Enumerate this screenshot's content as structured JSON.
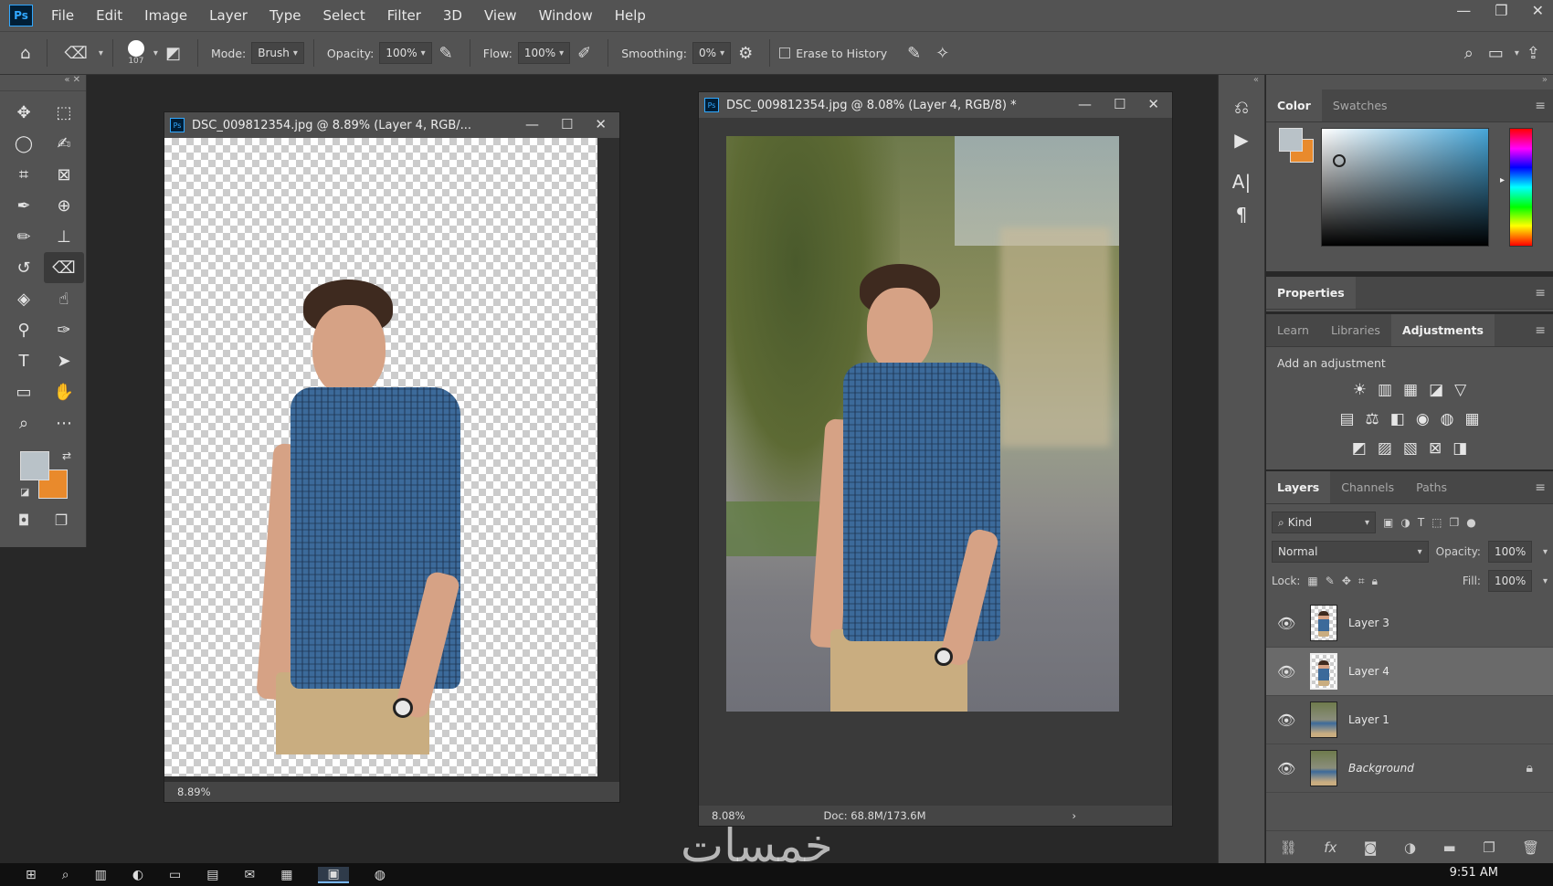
{
  "app": {
    "logo": "Ps",
    "menu": [
      "File",
      "Edit",
      "Image",
      "Layer",
      "Type",
      "Select",
      "Filter",
      "3D",
      "View",
      "Window",
      "Help"
    ],
    "window_controls": [
      "—",
      "❐",
      "✕"
    ]
  },
  "options_bar": {
    "brush_size": "107",
    "mode_label": "Mode:",
    "mode_value": "Brush",
    "opacity_label": "Opacity:",
    "opacity_value": "100%",
    "flow_label": "Flow:",
    "flow_value": "100%",
    "smoothing_label": "Smoothing:",
    "smoothing_value": "0%",
    "erase_to_history_label": "Erase to History"
  },
  "toolbar": {
    "foreground_color": "#b9c2c8",
    "background_color": "#e98a2c"
  },
  "documents": [
    {
      "title": "DSC_009812354.jpg @ 8.89% (Layer 4, RGB/...",
      "zoom": "8.89%"
    },
    {
      "title": "DSC_009812354.jpg @ 8.08% (Layer 4, RGB/8) *",
      "zoom": "8.08%",
      "doc_info": "Doc: 68.8M/173.6M"
    }
  ],
  "color_panel": {
    "tabs": [
      "Color",
      "Swatches"
    ],
    "active_tab": "Color"
  },
  "properties_panel": {
    "title": "Properties"
  },
  "adjustments_panel": {
    "tabs": [
      "Learn",
      "Libraries",
      "Adjustments"
    ],
    "active_tab": "Adjustments",
    "add_label": "Add an adjustment"
  },
  "layers_panel": {
    "tabs": [
      "Layers",
      "Channels",
      "Paths"
    ],
    "active_tab": "Layers",
    "filter_label": "Kind",
    "blend_mode": "Normal",
    "opacity_label": "Opacity:",
    "opacity_value": "100%",
    "lock_label": "Lock:",
    "fill_label": "Fill:",
    "fill_value": "100%",
    "layers": [
      {
        "name": "Layer 3",
        "selected": false,
        "thumb": "check"
      },
      {
        "name": "Layer 4",
        "selected": true,
        "thumb": "check"
      },
      {
        "name": "Layer 1",
        "selected": false,
        "thumb": "photo"
      },
      {
        "name": "Background",
        "selected": false,
        "thumb": "photo",
        "locked": true
      }
    ]
  },
  "watermark": "خمسات",
  "taskbar": {
    "clock": "9:51 AM"
  }
}
